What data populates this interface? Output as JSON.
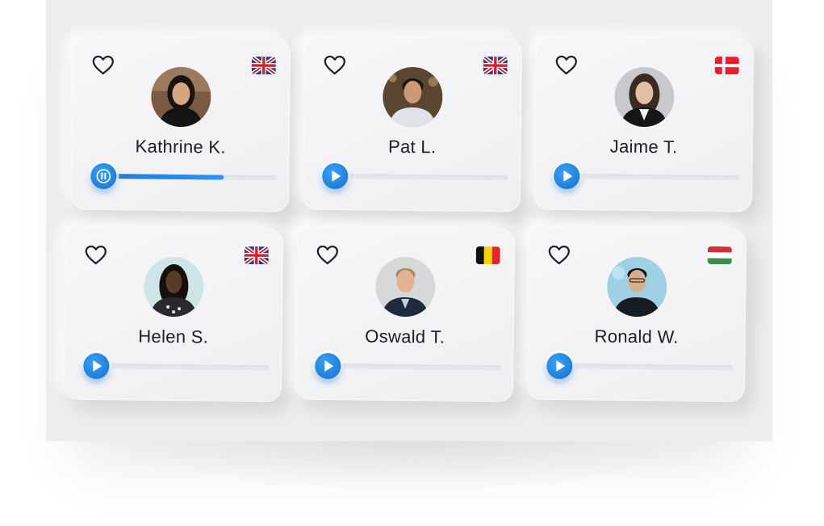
{
  "cards": [
    {
      "name": "Kathrine K.",
      "flag": "uk-flag",
      "state": "pause-icon",
      "progress": 0.7
    },
    {
      "name": "Pat L.",
      "flag": "uk-flag",
      "state": "play-icon",
      "progress": 0
    },
    {
      "name": "Jaime T.",
      "flag": "denmark-flag",
      "state": "play-icon",
      "progress": 0
    },
    {
      "name": "Helen S.",
      "flag": "uk-flag",
      "state": "play-icon",
      "progress": 0
    },
    {
      "name": "Oswald T.",
      "flag": "belgium-flag",
      "state": "play-icon",
      "progress": 0
    },
    {
      "name": "Ronald W.",
      "flag": "hungary-flag",
      "state": "play-icon",
      "progress": 0
    }
  ],
  "colors": {
    "accent": "#1d7fe0",
    "panel": "#ededef",
    "text": "#1d1d22"
  }
}
